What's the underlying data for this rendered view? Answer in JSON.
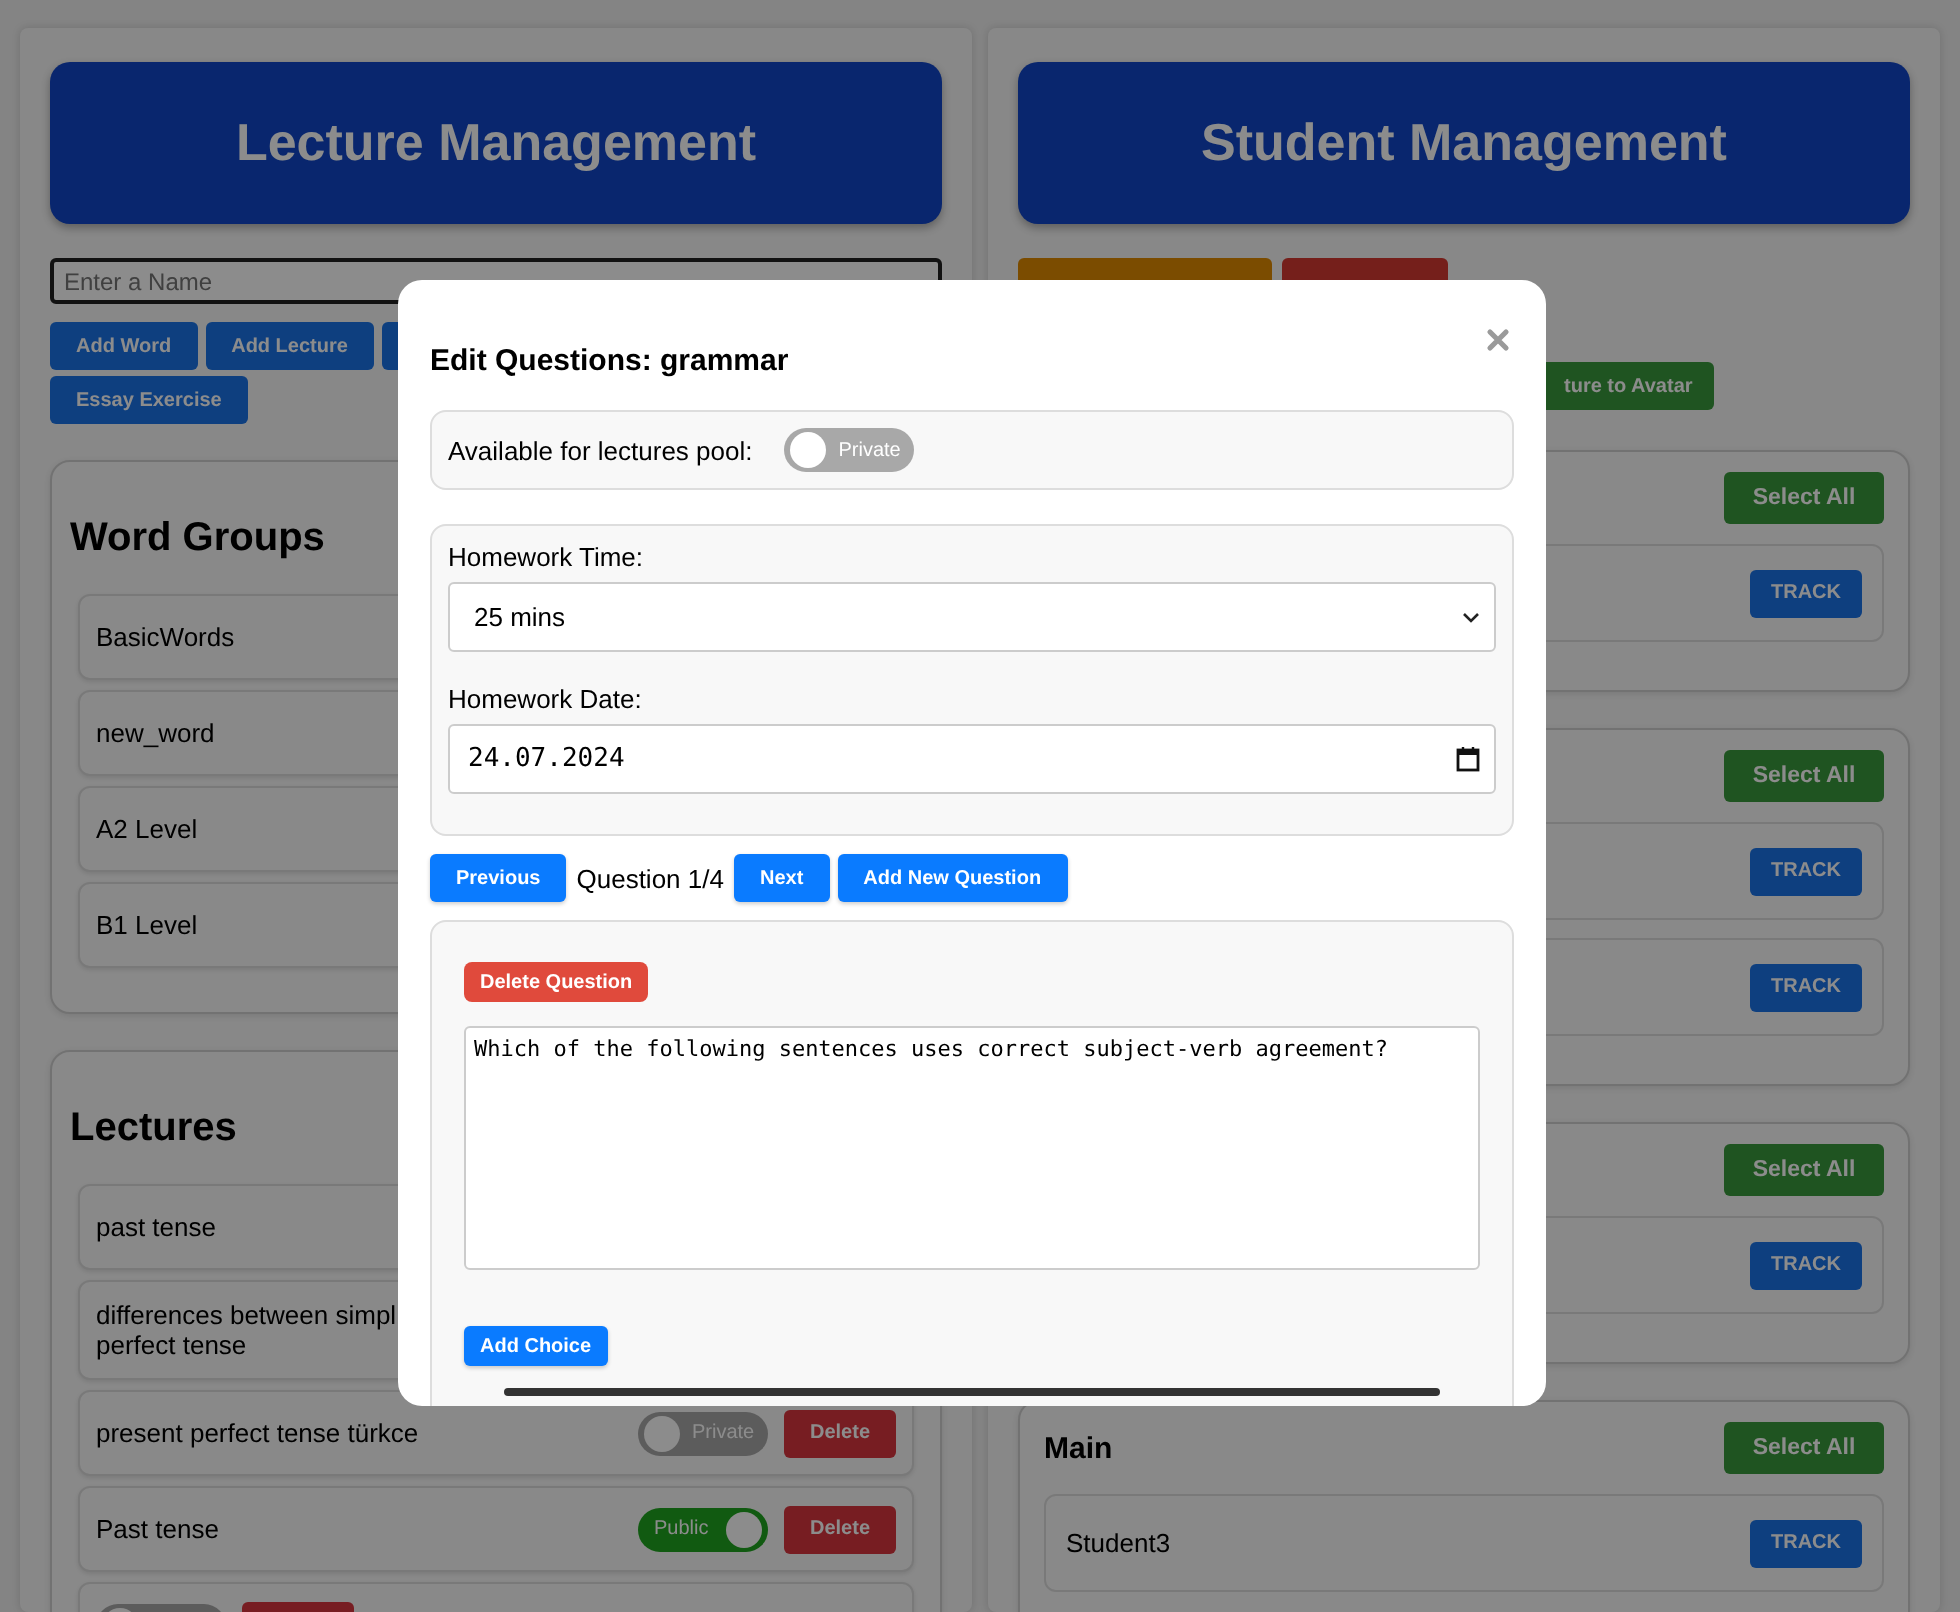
{
  "lecture_management": {
    "title": "Lecture Management",
    "name_field": {
      "placeholder": "Enter a Name"
    },
    "buttons": [
      {
        "kind": "button",
        "label": "Add Word"
      },
      {
        "kind": "button",
        "label": "Add Lecture"
      },
      {
        "kind": "covered"
      },
      {
        "kind": "button",
        "label": "Essay Exercise"
      }
    ],
    "word_groups": {
      "title": "Word Groups",
      "items": [
        "BasicWords",
        "new_word",
        "A2 Level",
        "B1 Level"
      ]
    },
    "lectures": {
      "title": "Lectures",
      "items": [
        {
          "lines": [
            "past tense"
          ]
        },
        {
          "lines": [
            "differences between simpl",
            "perfect tense"
          ]
        },
        {
          "lines": [
            "present perfect tense türkce"
          ],
          "public": false,
          "toggle_label": "Private",
          "delete": "Delete"
        },
        {
          "lines": [
            "Past tense"
          ],
          "public": true,
          "toggle_label": "Public",
          "delete": "Delete"
        },
        {
          "public": false
        }
      ]
    }
  },
  "student_management": {
    "title": "Student Management",
    "action_buttons": [
      {
        "kind": "warning"
      },
      {
        "kind": "danger"
      },
      {
        "kind": "success",
        "label": "ture to Avatar"
      }
    ],
    "groups": [
      {
        "select_all": "Select All",
        "students": [
          {
            "track": "TRACK"
          }
        ]
      },
      {
        "select_all": "Select All",
        "students": [
          {
            "track": "TRACK"
          },
          {
            "track": "TRACK"
          }
        ]
      },
      {
        "select_all": "Select All",
        "students": [
          {
            "track": "TRACK"
          }
        ]
      },
      {
        "name": "Main",
        "select_all": "Select All",
        "students": [
          {
            "name": "Student3",
            "track": "TRACK"
          }
        ]
      }
    ]
  },
  "modal": {
    "title": "Edit Questions: grammar",
    "pool": {
      "label": "Available for lectures pool:",
      "public": false,
      "toggle_label": "Private"
    },
    "homework_time": {
      "label": "Homework Time:",
      "value": "25 mins"
    },
    "homework_date": {
      "label": "Homework Date:",
      "value": "24.07.2024"
    },
    "nav": {
      "previous": "Previous",
      "counter": "Question 1/4",
      "next": "Next",
      "add": "Add New Question"
    },
    "question": {
      "delete": "Delete Question",
      "text": "Which of the following sentences uses correct subject-verb agreement?",
      "add_choice": "Add Choice"
    }
  }
}
